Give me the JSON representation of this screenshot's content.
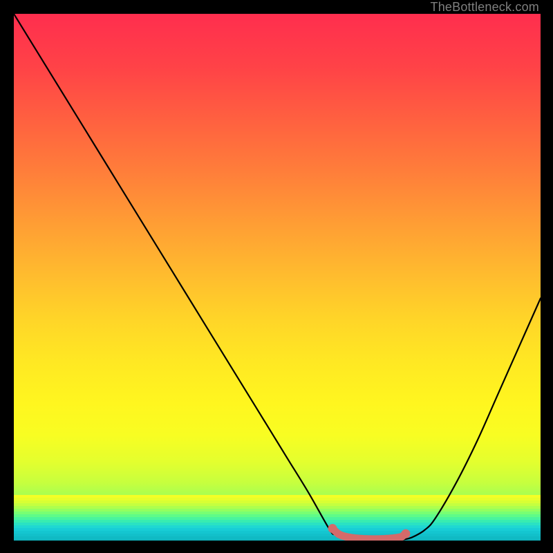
{
  "watermark": "TheBottleneck.com",
  "chart_data": {
    "type": "line",
    "title": "",
    "xlabel": "",
    "ylabel": "",
    "xlim": [
      0,
      100
    ],
    "ylim": [
      0,
      100
    ],
    "grid": false,
    "legend": false,
    "series": [
      {
        "name": "curve",
        "color": "#000000",
        "x": [
          0,
          4,
          8,
          12,
          16,
          20,
          24,
          28,
          32,
          36,
          40,
          44,
          48,
          52,
          56,
          60,
          61,
          62,
          63,
          64,
          66,
          68,
          70,
          72,
          73,
          74,
          75,
          76,
          78,
          80,
          84,
          88,
          92,
          96,
          100
        ],
        "y": [
          100,
          93.5,
          87,
          80.5,
          74,
          67.5,
          61,
          54.5,
          48,
          41.5,
          35,
          28.5,
          22,
          15.5,
          9,
          2,
          1.2,
          0.6,
          0.25,
          0.12,
          0.05,
          0.03,
          0.03,
          0.05,
          0.1,
          0.2,
          0.4,
          0.8,
          2,
          4.2,
          11,
          19,
          28,
          37,
          46
        ]
      },
      {
        "name": "markers",
        "color": "#d46a6a",
        "type": "scatter-path",
        "points": [
          {
            "x": 60.5,
            "y": 2.3
          },
          {
            "x": 61.1,
            "y": 1.7
          },
          {
            "x": 61.7,
            "y": 1.2
          },
          {
            "x": 62.4,
            "y": 0.9
          },
          {
            "x": 63.2,
            "y": 0.7
          },
          {
            "x": 64.0,
            "y": 0.55
          },
          {
            "x": 64.8,
            "y": 0.45
          },
          {
            "x": 65.6,
            "y": 0.38
          },
          {
            "x": 66.4,
            "y": 0.33
          },
          {
            "x": 67.2,
            "y": 0.3
          },
          {
            "x": 68.0,
            "y": 0.28
          },
          {
            "x": 68.8,
            "y": 0.28
          },
          {
            "x": 69.6,
            "y": 0.3
          },
          {
            "x": 70.4,
            "y": 0.33
          },
          {
            "x": 71.2,
            "y": 0.38
          },
          {
            "x": 72.0,
            "y": 0.45
          },
          {
            "x": 72.8,
            "y": 0.55
          },
          {
            "x": 73.6,
            "y": 0.7
          },
          {
            "x": 74.4,
            "y": 1.3
          }
        ]
      }
    ],
    "background_gradient": {
      "stops": [
        {
          "pos": 0.0,
          "color": "#ff2e4e"
        },
        {
          "pos": 0.1,
          "color": "#ff4247"
        },
        {
          "pos": 0.2,
          "color": "#ff6040"
        },
        {
          "pos": 0.3,
          "color": "#ff7e3a"
        },
        {
          "pos": 0.4,
          "color": "#ff9e34"
        },
        {
          "pos": 0.5,
          "color": "#ffbd2e"
        },
        {
          "pos": 0.58,
          "color": "#ffd528"
        },
        {
          "pos": 0.66,
          "color": "#ffe823"
        },
        {
          "pos": 0.74,
          "color": "#fff61f"
        },
        {
          "pos": 0.8,
          "color": "#f8fd22"
        },
        {
          "pos": 0.85,
          "color": "#e4ff2e"
        },
        {
          "pos": 0.89,
          "color": "#c7ff3e"
        },
        {
          "pos": 0.92,
          "color": "#a1ff55"
        },
        {
          "pos": 0.945,
          "color": "#74ff74"
        },
        {
          "pos": 0.965,
          "color": "#48f79a"
        },
        {
          "pos": 0.98,
          "color": "#2ae9bd"
        },
        {
          "pos": 0.992,
          "color": "#17d8d8"
        },
        {
          "pos": 1.0,
          "color": "#10cccc"
        }
      ]
    }
  }
}
